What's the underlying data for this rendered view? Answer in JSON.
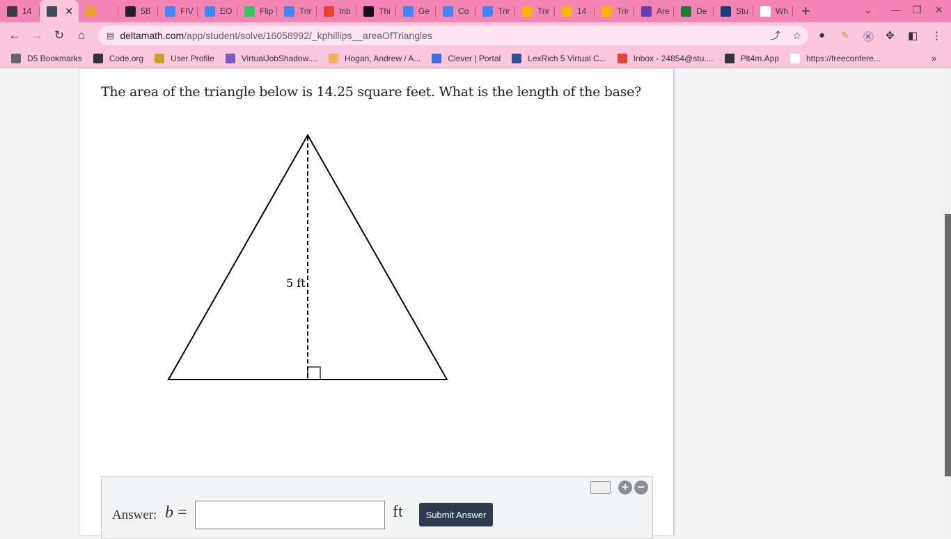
{
  "tabs": [
    {
      "label": "14",
      "color": "#3c3c3c"
    },
    {
      "label": "",
      "color": "#3c4a5a",
      "active": true
    },
    {
      "label": "",
      "color": "#e8a23a"
    },
    {
      "label": "5B",
      "color": "#222"
    },
    {
      "label": "FIV",
      "color": "#4285f4"
    },
    {
      "label": "EO",
      "color": "#4285f4"
    },
    {
      "label": "Flip",
      "color": "#31c95f"
    },
    {
      "label": "Trir",
      "color": "#4285f4"
    },
    {
      "label": "Inb",
      "color": "#ea4335"
    },
    {
      "label": "Thi",
      "color": "#111"
    },
    {
      "label": "Ge",
      "color": "#4285f4"
    },
    {
      "label": "Co",
      "color": "#4285f4"
    },
    {
      "label": "Trir",
      "color": "#4285f4"
    },
    {
      "label": "Trir",
      "color": "#f4b400"
    },
    {
      "label": "14",
      "color": "#f4b400"
    },
    {
      "label": "Trir",
      "color": "#f4b400"
    },
    {
      "label": "Are",
      "color": "#673ab7"
    },
    {
      "label": "De",
      "color": "#1e7a3a"
    },
    {
      "label": "Stu",
      "color": "#1c3f7a"
    },
    {
      "label": "Wh",
      "color": "#ffffff"
    }
  ],
  "url": {
    "host": "deltamath.com",
    "path": "/app/student/solve/16058992/_kphillips__areaOfTriangles"
  },
  "bookmarks": [
    {
      "label": "D5 Bookmarks",
      "color": "#666"
    },
    {
      "label": "Code.org",
      "color": "#333"
    },
    {
      "label": "User Profile",
      "color": "#c9a227"
    },
    {
      "label": "VirtualJobShadow....",
      "color": "#7a5cc7"
    },
    {
      "label": "Hogan, Andrew / A...",
      "color": "#f0b060"
    },
    {
      "label": "Clever | Portal",
      "color": "#3d6ee6"
    },
    {
      "label": "LexRich 5 Virtual C...",
      "color": "#2d4e9e"
    },
    {
      "label": "Inbox - 24854@stu....",
      "color": "#ea4335"
    },
    {
      "label": "Plt4m.App",
      "color": "#333"
    },
    {
      "label": "https://freeconfere...",
      "color": "#ffffff"
    }
  ],
  "question": "The area of the triangle below is 14.25 square feet. What is the length of the base?",
  "figure": {
    "height_label": "5 ft"
  },
  "answer": {
    "label": "Answer:",
    "variable": "b",
    "equals": "=",
    "value": "",
    "unit": "ft",
    "submit": "Submit Answer"
  }
}
